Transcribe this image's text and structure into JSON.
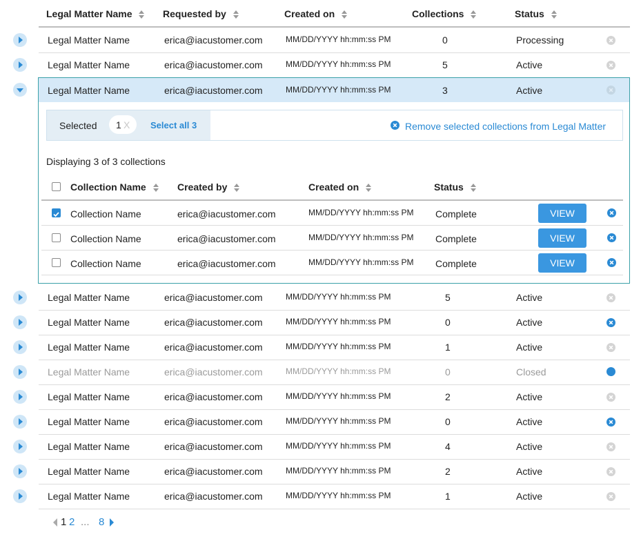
{
  "table": {
    "headers": {
      "name": "Legal Matter Name",
      "requested_by": "Requested by",
      "created_on": "Created on",
      "collections": "Collections",
      "status": "Status"
    },
    "rows": [
      {
        "name": "Legal Matter Name",
        "requested_by": "erica@iacustomer.com",
        "created_on": "MM/DD/YYYY hh:mm:ss PM",
        "collections": "0",
        "status": "Processing"
      },
      {
        "name": "Legal Matter Name",
        "requested_by": "erica@iacustomer.com",
        "created_on": "MM/DD/YYYY hh:mm:ss PM",
        "collections": "5",
        "status": "Active"
      },
      {
        "name": "Legal Matter Name",
        "requested_by": "erica@iacustomer.com",
        "created_on": "MM/DD/YYYY hh:mm:ss PM",
        "collections": "3",
        "status": "Active"
      },
      {
        "name": "Legal Matter Name",
        "requested_by": "erica@iacustomer.com",
        "created_on": "MM/DD/YYYY hh:mm:ss PM",
        "collections": "5",
        "status": "Active"
      },
      {
        "name": "Legal Matter Name",
        "requested_by": "erica@iacustomer.com",
        "created_on": "MM/DD/YYYY hh:mm:ss PM",
        "collections": "0",
        "status": "Active"
      },
      {
        "name": "Legal Matter Name",
        "requested_by": "erica@iacustomer.com",
        "created_on": "MM/DD/YYYY hh:mm:ss PM",
        "collections": "1",
        "status": "Active"
      },
      {
        "name": "Legal Matter Name",
        "requested_by": "erica@iacustomer.com",
        "created_on": "MM/DD/YYYY hh:mm:ss PM",
        "collections": "0",
        "status": "Closed"
      },
      {
        "name": "Legal Matter Name",
        "requested_by": "erica@iacustomer.com",
        "created_on": "MM/DD/YYYY hh:mm:ss PM",
        "collections": "2",
        "status": "Active"
      },
      {
        "name": "Legal Matter Name",
        "requested_by": "erica@iacustomer.com",
        "created_on": "MM/DD/YYYY hh:mm:ss PM",
        "collections": "0",
        "status": "Active"
      },
      {
        "name": "Legal Matter Name",
        "requested_by": "erica@iacustomer.com",
        "created_on": "MM/DD/YYYY hh:mm:ss PM",
        "collections": "4",
        "status": "Active"
      },
      {
        "name": "Legal Matter Name",
        "requested_by": "erica@iacustomer.com",
        "created_on": "MM/DD/YYYY hh:mm:ss PM",
        "collections": "2",
        "status": "Active"
      },
      {
        "name": "Legal Matter Name",
        "requested_by": "erica@iacustomer.com",
        "created_on": "MM/DD/YYYY hh:mm:ss PM",
        "collections": "1",
        "status": "Active"
      }
    ]
  },
  "expanded": {
    "selected_label": "Selected",
    "selected_count": "1",
    "clear_glyph": "X",
    "select_all": "Select all 3",
    "remove_selected": "Remove selected collections from Legal Matter",
    "displaying": "Displaying 3 of 3 collections",
    "headers": {
      "name": "Collection Name",
      "created_by": "Created by",
      "created_on": "Created on",
      "status": "Status"
    },
    "view_label": "VIEW",
    "rows": [
      {
        "checked": true,
        "name": "Collection Name",
        "created_by": "erica@iacustomer.com",
        "created_on": "MM/DD/YYYY hh:mm:ss PM",
        "status": "Complete"
      },
      {
        "checked": false,
        "name": "Collection Name",
        "created_by": "erica@iacustomer.com",
        "created_on": "MM/DD/YYYY hh:mm:ss PM",
        "status": "Complete"
      },
      {
        "checked": false,
        "name": "Collection Name",
        "created_by": "erica@iacustomer.com",
        "created_on": "MM/DD/YYYY hh:mm:ss PM",
        "status": "Complete"
      }
    ]
  },
  "pagination": {
    "page1": "1",
    "page2": "2",
    "ellipsis": "...",
    "last": "8"
  },
  "colors": {
    "accent": "#2a8ad4",
    "expander_bg": "#cfe6f7",
    "selected_row_bg": "#d6e9f8",
    "expanded_border": "#3aa0a8"
  }
}
